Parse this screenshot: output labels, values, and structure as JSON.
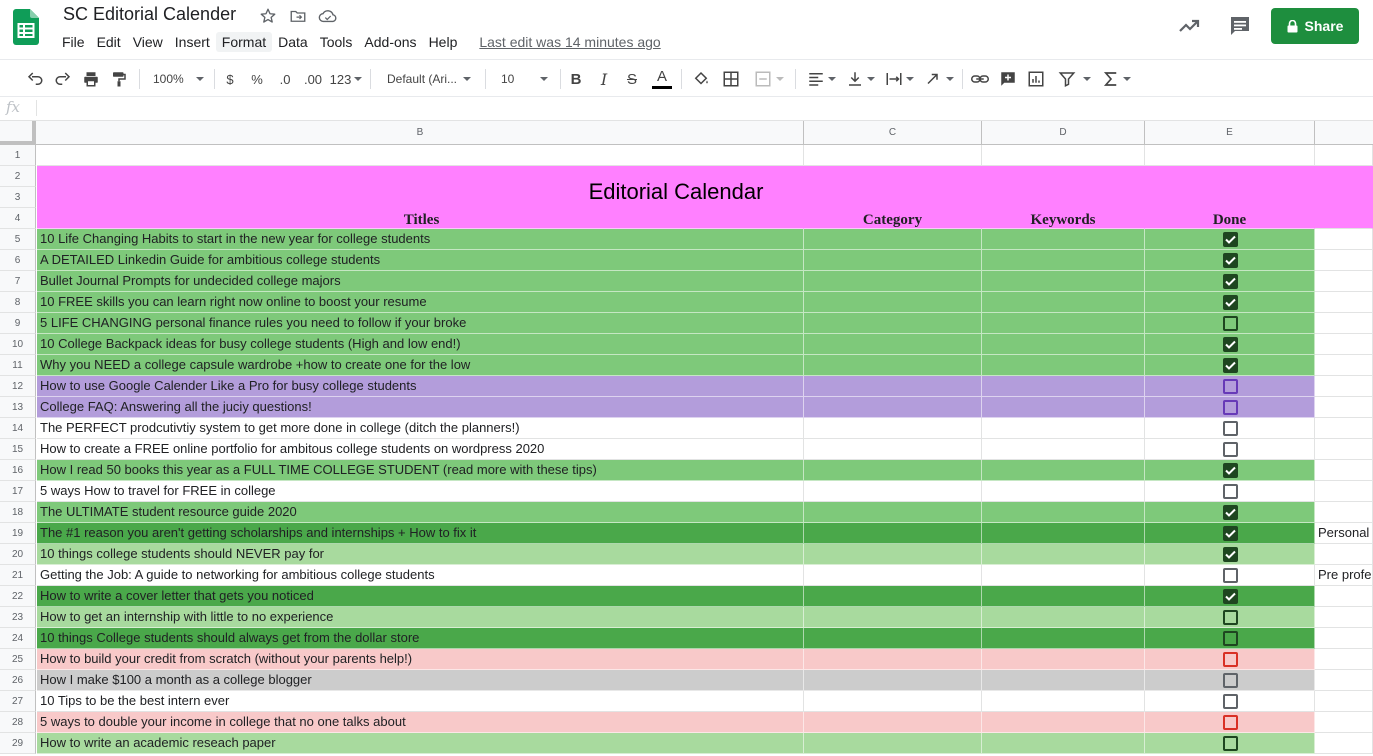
{
  "app": {
    "doc_title": "SC Editorial Calender",
    "last_edit": "Last edit was 14 minutes ago",
    "share_label": "Share",
    "colors": {
      "accent": "#1e8e3e",
      "sheets_green": "#0f9d58"
    }
  },
  "menu": [
    "File",
    "Edit",
    "View",
    "Insert",
    "Format",
    "Data",
    "Tools",
    "Add-ons",
    "Help"
  ],
  "toolbar": {
    "zoom": "100%",
    "currency": "$",
    "percent": "%",
    "dec_decrease": ".0",
    "dec_increase": ".00",
    "more_formats": "123",
    "font": "Default (Ari...",
    "font_size": "10",
    "bold": "B",
    "italic": "I",
    "strike": "S",
    "text_color": "A"
  },
  "formula_bar": {
    "fx": "fx",
    "value": ""
  },
  "columns": [
    "B",
    "C",
    "D",
    "E"
  ],
  "sheet": {
    "title": "Editorial Calendar",
    "headers": {
      "b": "Titles",
      "c": "Category",
      "d": "Keywords",
      "e": "Done"
    },
    "colors": {
      "title_bg": "#ff80ff",
      "green": "#7ec97a",
      "dark_green": "#4aa84a",
      "light_green": "#a8da9e",
      "purple": "#b39ddb",
      "pink": "#f8c9c9",
      "gray": "#cccccc",
      "white": "#ffffff"
    },
    "rows": [
      {
        "num": "1",
        "title": "",
        "fill": "white",
        "check": "none",
        "f": ""
      },
      {
        "num": "2",
        "title": "",
        "fill": "title",
        "check": "none",
        "f": ""
      },
      {
        "num": "3",
        "title": "",
        "fill": "title",
        "check": "none",
        "f": ""
      },
      {
        "num": "4",
        "title": "",
        "fill": "title",
        "check": "none",
        "f": ""
      },
      {
        "num": "5",
        "title": "10 Life Changing Habits to start in the new year for college students",
        "fill": "green",
        "check": "checked",
        "f": ""
      },
      {
        "num": "6",
        "title": "A DETAILED Linkedin Guide for ambitious college students",
        "fill": "green",
        "check": "checked",
        "f": ""
      },
      {
        "num": "7",
        "title": "Bullet Journal Prompts for undecided college majors",
        "fill": "green",
        "check": "checked",
        "f": ""
      },
      {
        "num": "8",
        "title": "10 FREE skills you can learn right now online to boost your resume",
        "fill": "green",
        "check": "checked",
        "f": ""
      },
      {
        "num": "9",
        "title": "5 LIFE CHANGING personal finance rules you need to follow if your broke",
        "fill": "green",
        "check": "unchecked",
        "f": ""
      },
      {
        "num": "10",
        "title": "10 College Backpack ideas for busy college students (High and low end!)",
        "fill": "green",
        "check": "checked",
        "f": ""
      },
      {
        "num": "11",
        "title": "Why you NEED a college capsule wardrobe +how to create one for the low",
        "fill": "green",
        "check": "checked",
        "f": ""
      },
      {
        "num": "12",
        "title": "How to use Google Calender Like a Pro for busy college students",
        "fill": "purple",
        "check": "unchecked",
        "f": ""
      },
      {
        "num": "13",
        "title": "College FAQ: Answering all the juciy questions!",
        "fill": "purple",
        "check": "unchecked",
        "f": ""
      },
      {
        "num": "14",
        "title": "The PERFECT prodcutivtiy system to get more done in college (ditch the planners!)",
        "fill": "white",
        "check": "unchecked",
        "f": ""
      },
      {
        "num": "15",
        "title": "How to create a FREE online portfolio for ambitous college students on wordpress 2020",
        "fill": "white",
        "check": "unchecked",
        "f": ""
      },
      {
        "num": "16",
        "title": "How I read 50 books this year as a FULL TIME COLLEGE STUDENT (read more with these tips)",
        "fill": "green",
        "check": "checked",
        "f": ""
      },
      {
        "num": "17",
        "title": "5 ways How to travel for FREE in college",
        "fill": "white",
        "check": "unchecked",
        "f": ""
      },
      {
        "num": "18",
        "title": "The ULTIMATE student resource guide 2020",
        "fill": "green",
        "check": "checked",
        "f": ""
      },
      {
        "num": "19",
        "title": "The #1 reason you aren't getting scholarships and internships + How to fix it",
        "fill": "dark_green",
        "check": "checked",
        "f": "Personal"
      },
      {
        "num": "20",
        "title": "10 things college students should NEVER pay for",
        "fill": "light_green",
        "check": "checked",
        "f": ""
      },
      {
        "num": "21",
        "title": "Getting the Job: A guide to networking for ambitious college students",
        "fill": "white",
        "check": "unchecked",
        "f": "Pre profe"
      },
      {
        "num": "22",
        "title": "How to write a cover letter that gets you noticed",
        "fill": "dark_green",
        "check": "checked",
        "f": ""
      },
      {
        "num": "23",
        "title": "How to get an internship with little to no experience",
        "fill": "light_green",
        "check": "unchecked",
        "f": ""
      },
      {
        "num": "24",
        "title": "10 things College students should always get from the dollar store",
        "fill": "dark_green",
        "check": "unchecked",
        "f": ""
      },
      {
        "num": "25",
        "title": "How to build your credit from scratch (without your parents help!)",
        "fill": "pink",
        "check": "unchecked",
        "f": ""
      },
      {
        "num": "26",
        "title": "How I make $100 a month as a college blogger",
        "fill": "gray",
        "check": "unchecked",
        "f": ""
      },
      {
        "num": "27",
        "title": "10 Tips to be the best intern ever",
        "fill": "white",
        "check": "unchecked",
        "f": ""
      },
      {
        "num": "28",
        "title": "5 ways to double your income in college that no one talks about",
        "fill": "pink",
        "check": "unchecked",
        "f": ""
      },
      {
        "num": "29",
        "title": "How to write an academic reseach paper",
        "fill": "light_green",
        "check": "unchecked",
        "f": ""
      }
    ]
  }
}
